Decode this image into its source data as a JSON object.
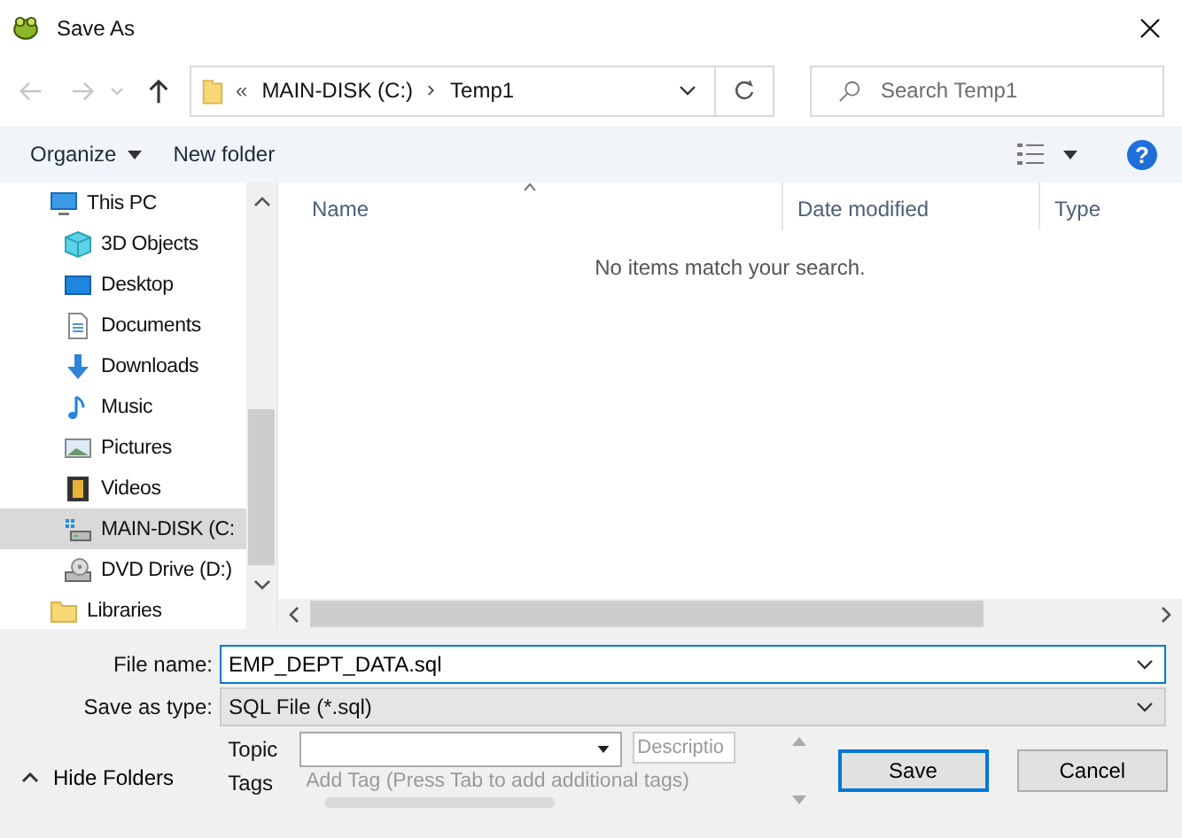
{
  "window": {
    "title": "Save As"
  },
  "history": {
    "back": {
      "disabled": true
    },
    "forward": {
      "disabled": true
    },
    "up": {
      "disabled": false
    }
  },
  "address": {
    "overflow": "«",
    "path": [
      "MAIN-DISK (C:)",
      "Temp1"
    ]
  },
  "search": {
    "placeholder": "Search Temp1"
  },
  "toolbar": {
    "organize": "Organize",
    "new_folder": "New folder",
    "help": "?"
  },
  "nav": [
    {
      "label": "This PC",
      "kind": "pc",
      "selected": false,
      "children": [
        {
          "label": "3D Objects",
          "kind": "cube",
          "selected": false
        },
        {
          "label": "Desktop",
          "kind": "desktop",
          "selected": false
        },
        {
          "label": "Documents",
          "kind": "document",
          "selected": false
        },
        {
          "label": "Downloads",
          "kind": "download",
          "selected": false
        },
        {
          "label": "Music",
          "kind": "music",
          "selected": false
        },
        {
          "label": "Pictures",
          "kind": "picture",
          "selected": false
        },
        {
          "label": "Videos",
          "kind": "video",
          "selected": false
        },
        {
          "label": "MAIN-DISK (C:",
          "kind": "drive",
          "selected": true
        },
        {
          "label": "DVD Drive (D:)",
          "kind": "dvd",
          "selected": false
        }
      ]
    },
    {
      "label": "Libraries",
      "kind": "folder",
      "selected": false
    }
  ],
  "table": {
    "columns": [
      "Name",
      "Date modified",
      "Type"
    ],
    "empty_message": "No items match your search."
  },
  "file_name": {
    "label": "File name:",
    "value": "EMP_DEPT_DATA.sql"
  },
  "save_type": {
    "label": "Save as type:",
    "value": "SQL File (*.sql)"
  },
  "metadata": {
    "topic_label": "Topic",
    "tags_label": "Tags",
    "description_placeholder": "Descriptio",
    "tags_placeholder": "Add Tag (Press Tab to add additional tags)"
  },
  "hide_folders": "Hide Folders",
  "buttons": [
    {
      "label": "Save",
      "kind": "primary"
    },
    {
      "label": "Cancel",
      "kind": "normal"
    }
  ]
}
